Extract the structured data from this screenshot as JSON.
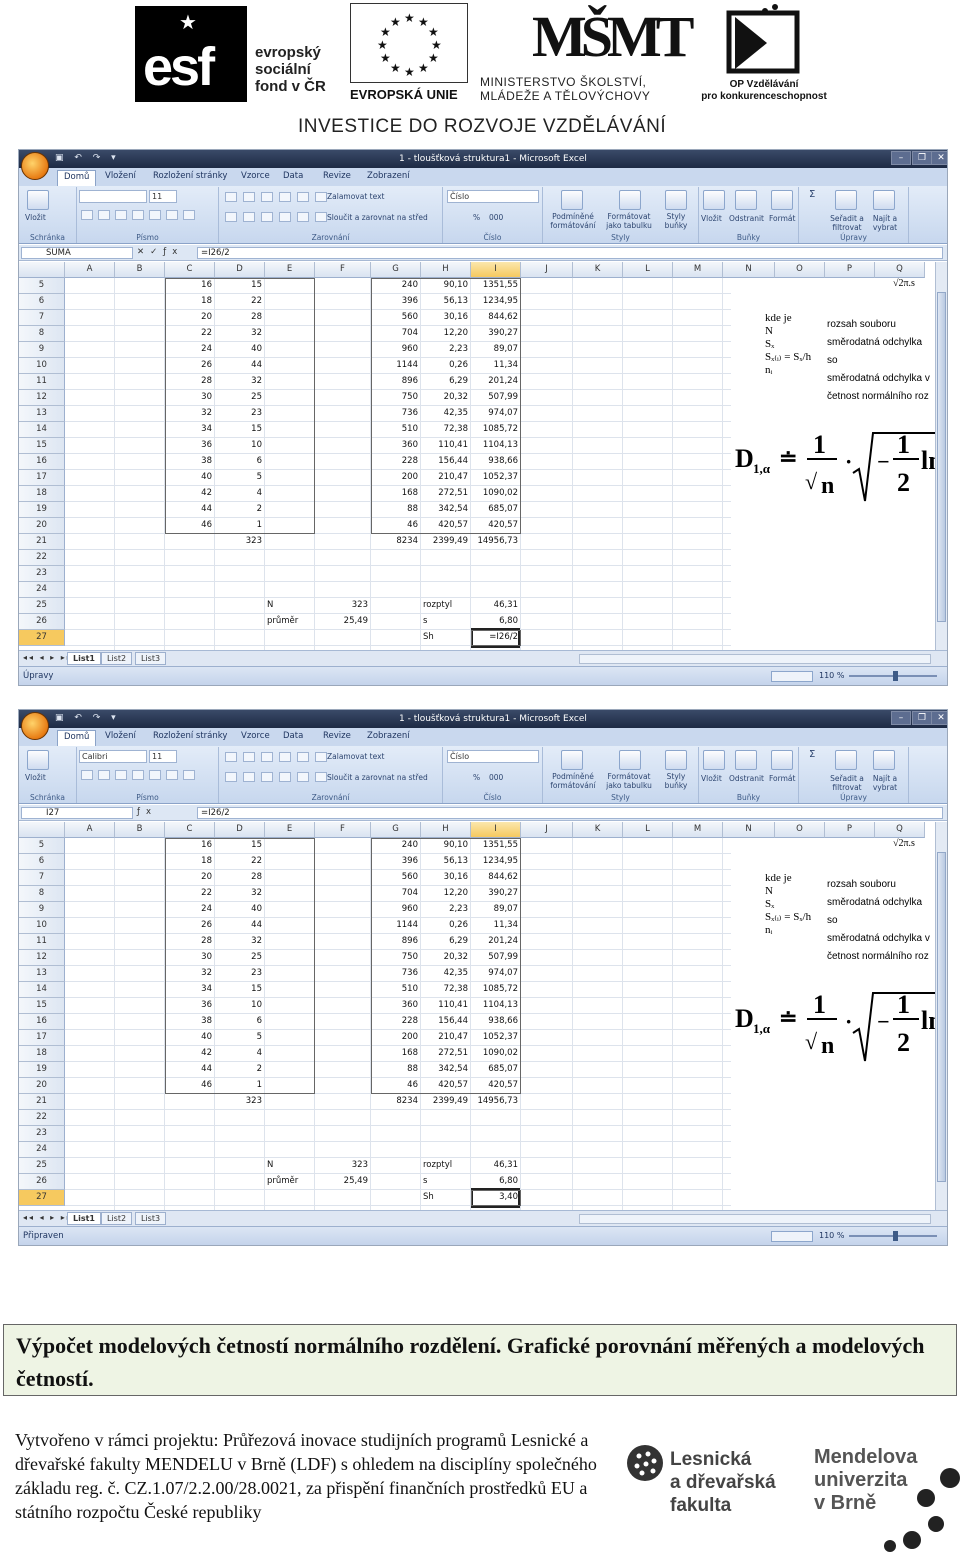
{
  "header": {
    "esf_mark": "esf",
    "esf_lines": [
      "evropský",
      "sociální",
      "fond v ČR"
    ],
    "eu_label": "EVROPSKÁ UNIE",
    "msmt_mark": "MŠMT",
    "msmt_lines": [
      "MINISTERSTVO ŠKOLSTVÍ,",
      "MLÁDEŽE A TĚLOVÝCHOVY"
    ],
    "op_lines": [
      "OP Vzdělávání",
      "pro konkurenceschopnost"
    ],
    "investice": "INVESTICE DO ROZVOJE VZDĚLÁVÁNÍ"
  },
  "excel": {
    "window_title": "1 - tloušťková struktura1 - Microsoft Excel",
    "tabs": [
      "Domů",
      "Vložení",
      "Rozložení stránky",
      "Vzorce",
      "Data",
      "Revize",
      "Zobrazení"
    ],
    "ribbon": {
      "clipboard_label": "Schránka",
      "paste": "Vložit",
      "font_group": "Písmo",
      "align_group": "Zarovnání",
      "wrap_text": "Zalamovat text",
      "merge_center": "Sloučit a zarovnat na střed",
      "number_group": "Číslo",
      "number_format": "Číslo",
      "percent": "%",
      "thousands": "000",
      "cond_format": "Podmíněné formátování",
      "format_table": "Formátovat jako tabulku",
      "cell_styles": "Styly buňky",
      "styles_group": "Styly",
      "insert": "Vložit",
      "delete": "Odstranit",
      "format": "Formát",
      "cells_group": "Buňky",
      "sort": "Seřadit a filtrovat",
      "find": "Najít a vybrat",
      "edit_group": "Úpravy",
      "font_size": "11"
    },
    "columns": [
      "A",
      "B",
      "C",
      "D",
      "E",
      "F",
      "G",
      "H",
      "I",
      "J",
      "K",
      "L",
      "M",
      "N",
      "O",
      "P",
      "Q"
    ],
    "rows": [
      {
        "n": "5",
        "c": "16",
        "d": "15",
        "g": "240",
        "h": "90,10",
        "i": "1351,55"
      },
      {
        "n": "6",
        "c": "18",
        "d": "22",
        "g": "396",
        "h": "56,13",
        "i": "1234,95"
      },
      {
        "n": "7",
        "c": "20",
        "d": "28",
        "g": "560",
        "h": "30,16",
        "i": "844,62"
      },
      {
        "n": "8",
        "c": "22",
        "d": "32",
        "g": "704",
        "h": "12,20",
        "i": "390,27"
      },
      {
        "n": "9",
        "c": "24",
        "d": "40",
        "g": "960",
        "h": "2,23",
        "i": "89,07"
      },
      {
        "n": "10",
        "c": "26",
        "d": "44",
        "g": "1144",
        "h": "0,26",
        "i": "11,34"
      },
      {
        "n": "11",
        "c": "28",
        "d": "32",
        "g": "896",
        "h": "6,29",
        "i": "201,24"
      },
      {
        "n": "12",
        "c": "30",
        "d": "25",
        "g": "750",
        "h": "20,32",
        "i": "507,99"
      },
      {
        "n": "13",
        "c": "32",
        "d": "23",
        "g": "736",
        "h": "42,35",
        "i": "974,07"
      },
      {
        "n": "14",
        "c": "34",
        "d": "15",
        "g": "510",
        "h": "72,38",
        "i": "1085,72"
      },
      {
        "n": "15",
        "c": "36",
        "d": "10",
        "g": "360",
        "h": "110,41",
        "i": "1104,13"
      },
      {
        "n": "16",
        "c": "38",
        "d": "6",
        "g": "228",
        "h": "156,44",
        "i": "938,66"
      },
      {
        "n": "17",
        "c": "40",
        "d": "5",
        "g": "200",
        "h": "210,47",
        "i": "1052,37"
      },
      {
        "n": "18",
        "c": "42",
        "d": "4",
        "g": "168",
        "h": "272,51",
        "i": "1090,02"
      },
      {
        "n": "19",
        "c": "44",
        "d": "2",
        "g": "88",
        "h": "342,54",
        "i": "685,07"
      },
      {
        "n": "20",
        "c": "46",
        "d": "1",
        "g": "46",
        "h": "420,57",
        "i": "420,57"
      },
      {
        "n": "21",
        "c": "",
        "d": "323",
        "g": "8234",
        "h": "2399,49",
        "i": "14956,73"
      },
      {
        "n": "22"
      },
      {
        "n": "23"
      },
      {
        "n": "24"
      },
      {
        "n": "25",
        "e": "N",
        "f": "323",
        "h": "rozptyl",
        "i": "46,31"
      },
      {
        "n": "26",
        "e": "průměr",
        "f": "25,49",
        "h": "s",
        "i": "6,80"
      },
      {
        "n": "27",
        "h": "Sh"
      }
    ],
    "sheets": [
      "List1",
      "List2",
      "List3"
    ],
    "zoom": "110 %",
    "formula_notes": {
      "top": "√2π.s",
      "kde": [
        "kde je",
        "N",
        "Sₓ",
        "Sₓ₍ᵢ₎ = Sₓ/h",
        "nᵢ"
      ],
      "legend": [
        "rozsah souboru",
        "směrodatná odchylka so",
        "směrodatná odchylka v",
        "četnost normálního roz"
      ],
      "big": "D₁,α ≐ 1/√n · √(−½ ln"
    }
  },
  "shot1": {
    "name_box": "SUMA",
    "formula": "=I26/2",
    "status": "Úpravy",
    "i27": "=I26/2",
    "sel_row": "27"
  },
  "shot2": {
    "name_box": "I27",
    "formula": "=I26/2",
    "status": "Připraven",
    "i27": "3,40",
    "sel_row": "27"
  },
  "caption": "Výpočet modelových četností normálního rozdělení. Grafické porovnání měřených a modelových četností.",
  "footer": {
    "text": "Vytvořeno v rámci projektu: Průřezová inovace studijních programů Lesnické a dřevařské fakulty MENDELU v Brně (LDF) s ohledem na disciplíny společného základu reg. č. CZ.1.07/2.2.00/28.0021, za přispění finančních prostředků EU a státního rozpočtu České republiky",
    "ldf_lines": [
      "Lesnická",
      "a dřevařská",
      "fakulta"
    ],
    "mendel_lines": [
      "Mendelova",
      "univerzita",
      "v Brně"
    ]
  }
}
